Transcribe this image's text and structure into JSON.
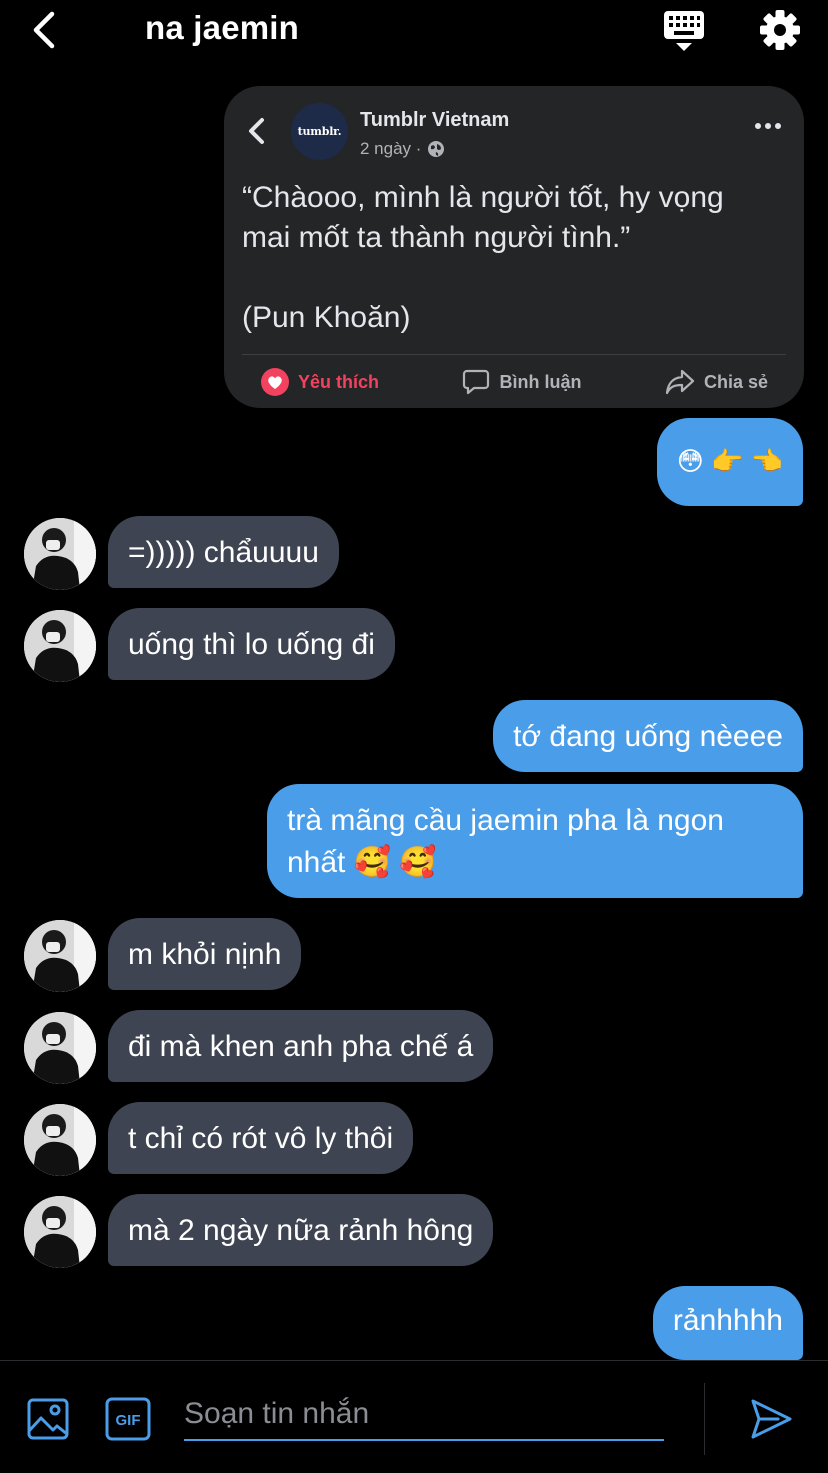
{
  "header": {
    "title": "na jaemin"
  },
  "shared_post": {
    "avatar_text": "tumblr.",
    "author": "Tumblr Vietnam",
    "time": "2 ngày ·",
    "text": "“Chàooo, mình là người tốt, hy vọng\nmai mốt ta thành người tình.”\n\n(Pun Khoăn)",
    "actions": {
      "like": "Yêu thích",
      "comment": "Bình luận",
      "share": "Chia sẻ"
    }
  },
  "messages": [
    {
      "from": "me",
      "text": "😳 👉 👈"
    },
    {
      "from": "them",
      "text": "=))))) chẩuuuu"
    },
    {
      "from": "them",
      "text": "uống thì lo uống đi"
    },
    {
      "from": "me",
      "text": "tớ đang uống nèeee"
    },
    {
      "from": "me",
      "text": "trà mãng cầu jaemin pha là ngon\nnhất 🥰 🥰"
    },
    {
      "from": "them",
      "text": "m khỏi nịnh"
    },
    {
      "from": "them",
      "text": "đi mà khen anh pha chế á"
    },
    {
      "from": "them",
      "text": "t chỉ có rót vô ly thôi"
    },
    {
      "from": "them",
      "text": "mà 2 ngày nữa rảnh hông"
    },
    {
      "from": "me",
      "text": "rảnhhhh"
    }
  ],
  "composer": {
    "placeholder": "Soạn tin nhắn",
    "gif_label": "GIF"
  },
  "colors": {
    "outgoing_bubble": "#4a9de9",
    "incoming_bubble": "#3e4451",
    "like_red": "#f3425f",
    "background": "#000000"
  },
  "icons": [
    "back-arrow-icon",
    "keyboard-icon",
    "gear-icon",
    "image-icon",
    "gif-icon",
    "send-icon",
    "globe-icon",
    "heart-icon",
    "comment-icon",
    "share-icon",
    "more-dots-icon"
  ]
}
